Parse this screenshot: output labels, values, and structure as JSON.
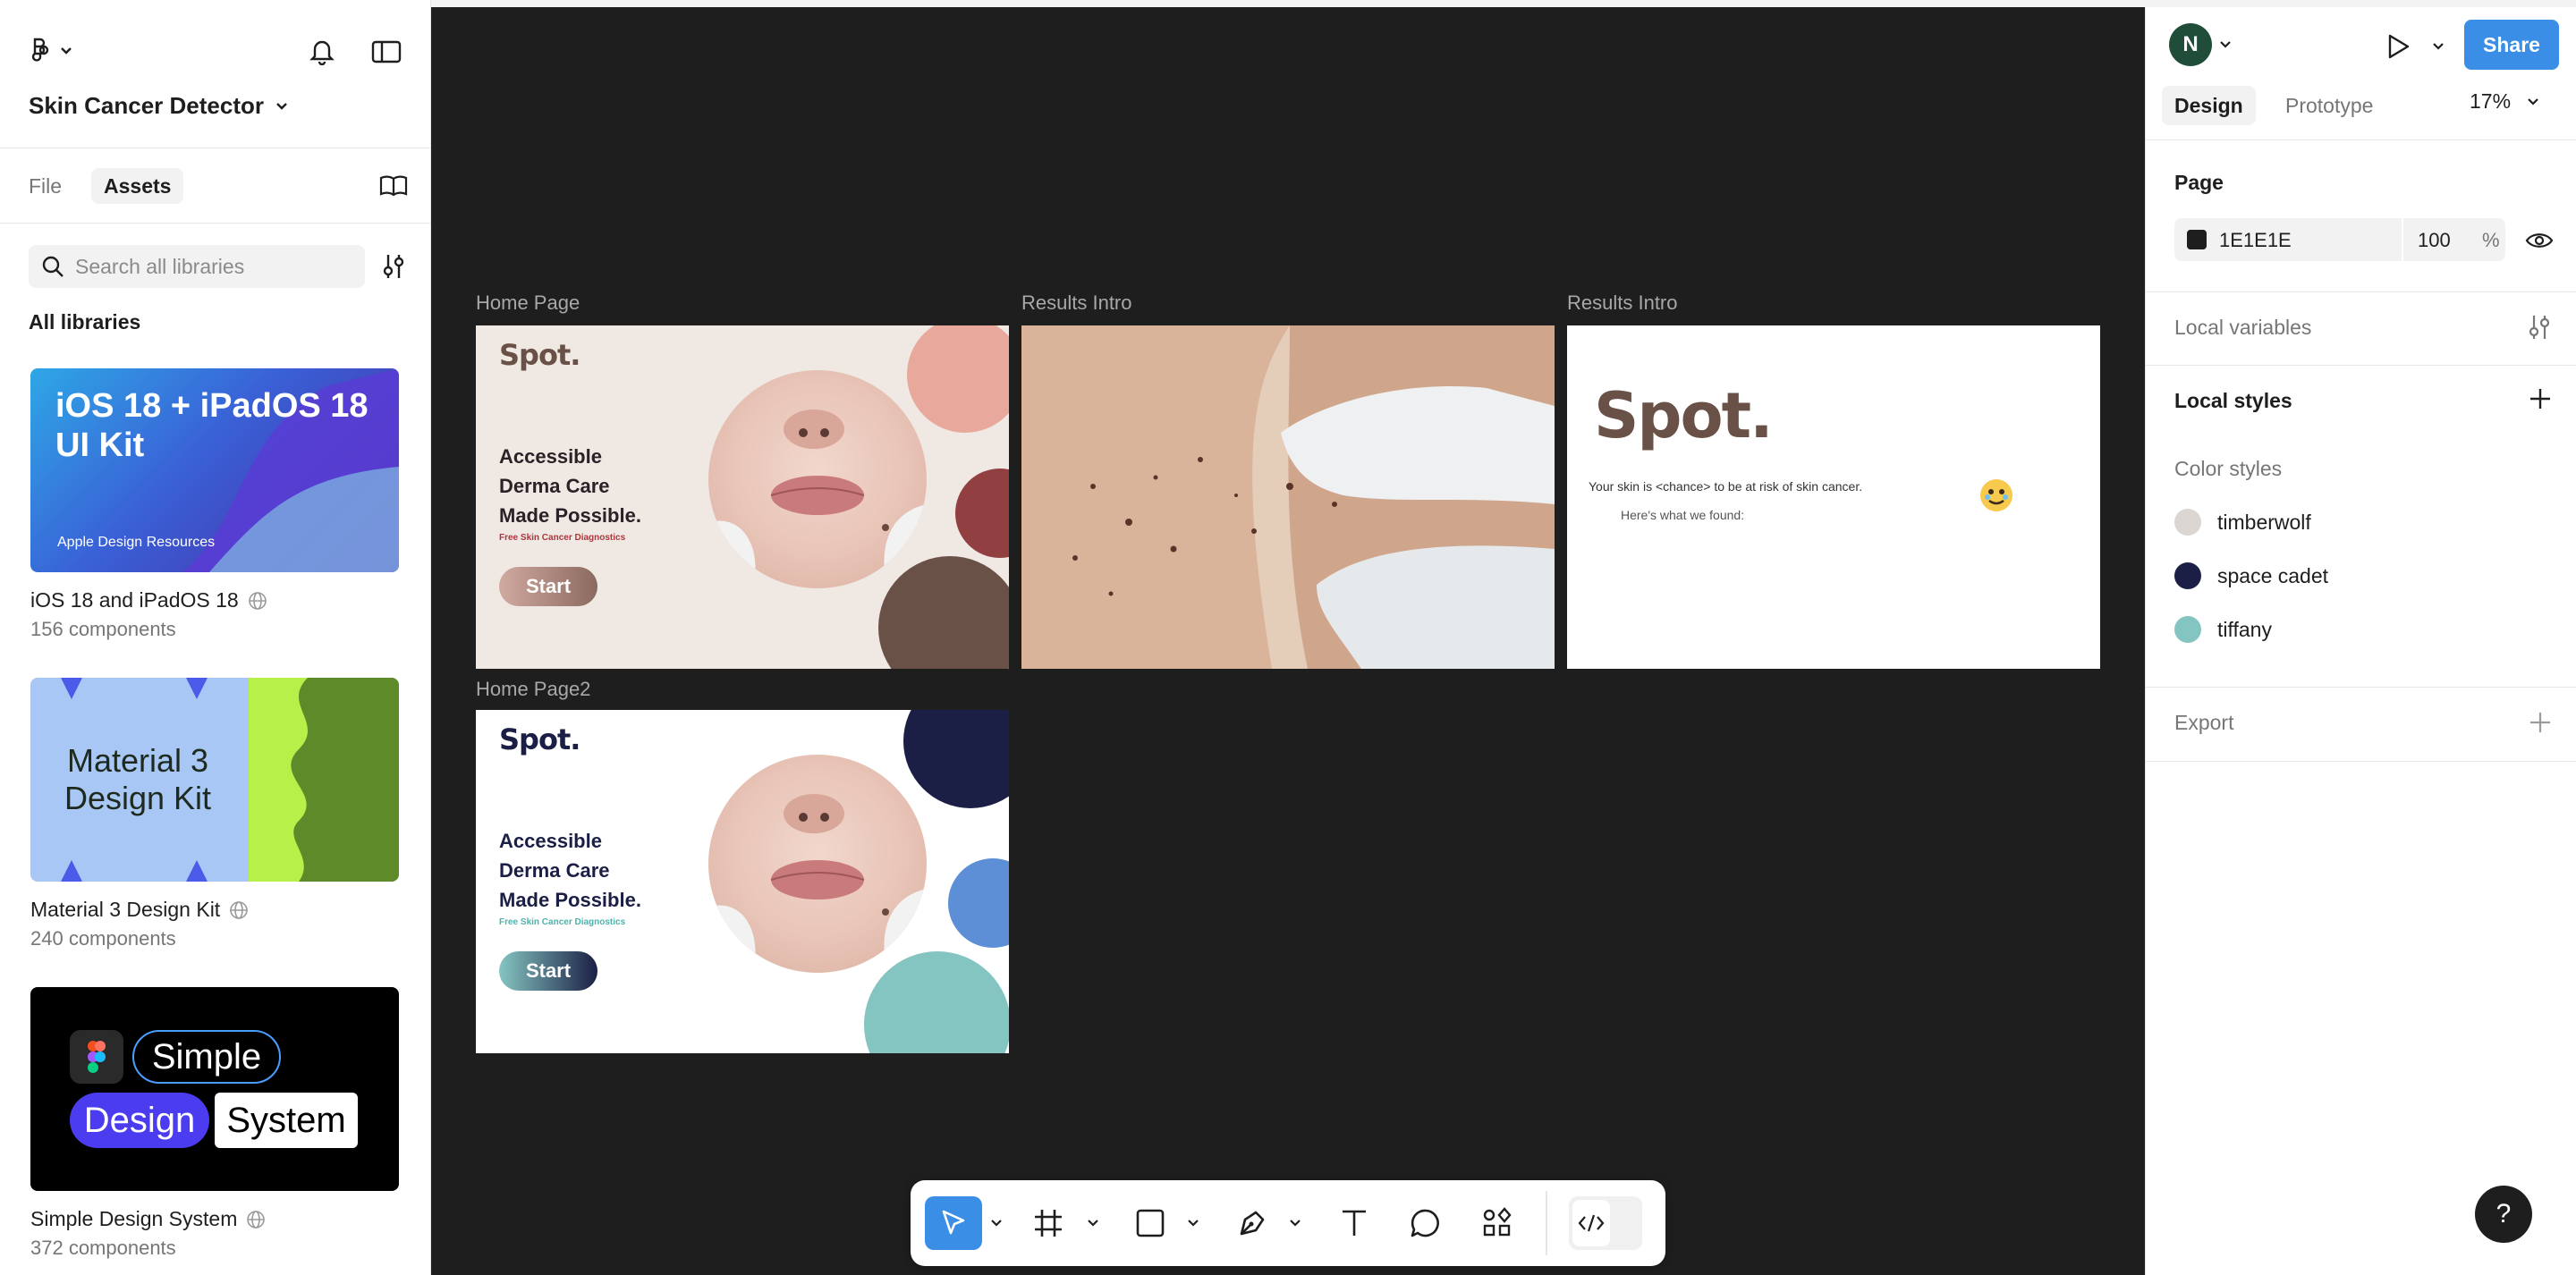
{
  "app": {
    "project_title": "Skin Cancer Detector"
  },
  "left": {
    "tabs": [
      {
        "label": "File"
      },
      {
        "label": "Assets"
      }
    ],
    "search": {
      "placeholder": "Search all libraries"
    },
    "section_title": "All libraries",
    "libraries": [
      {
        "name": "iOS 18 and iPadOS 18",
        "count": "156 components",
        "thumb_title": "iOS 18 + iPadOS 18 UI Kit",
        "thumb_footer": "Apple Design Resources"
      },
      {
        "name": "Material 3 Design Kit",
        "count": "240 components",
        "thumb_title": "Material 3 Design Kit"
      },
      {
        "name": "Simple Design System",
        "count": "372 components",
        "thumb_words": [
          "Simple",
          "Design",
          "System"
        ]
      }
    ]
  },
  "canvas": {
    "frames": [
      {
        "label": "Home Page",
        "logo": "Spot.",
        "headline": [
          "Accessible",
          "Derma Care",
          "Made Possible."
        ],
        "sub": "Free Skin Cancer Diagnostics",
        "button": "Start"
      },
      {
        "label": "Results Intro"
      },
      {
        "label": "Results Intro",
        "logo": "Spot.",
        "line1": "Your skin is <chance> to be at risk of skin cancer.",
        "line2": "Here's what we found:"
      },
      {
        "label": "Home Page2",
        "logo": "Spot.",
        "headline": [
          "Accessible",
          "Derma Care",
          "Made Possible."
        ],
        "sub": "Free Skin Cancer Diagnostics",
        "button": "Start"
      }
    ]
  },
  "right": {
    "avatar": "N",
    "share": "Share",
    "tabs": [
      {
        "label": "Design"
      },
      {
        "label": "Prototype"
      }
    ],
    "zoom": "17%",
    "page": {
      "title": "Page",
      "color": "1E1E1E",
      "opacity": "100",
      "unit": "%"
    },
    "local_variables": "Local variables",
    "local_styles": "Local styles",
    "color_styles_title": "Color styles",
    "color_styles": [
      {
        "name": "timberwolf",
        "color": "#dcd6d3"
      },
      {
        "name": "space cadet",
        "color": "#1b1f45"
      },
      {
        "name": "tiffany",
        "color": "#85c5c1"
      }
    ],
    "export": "Export",
    "help": "?"
  }
}
